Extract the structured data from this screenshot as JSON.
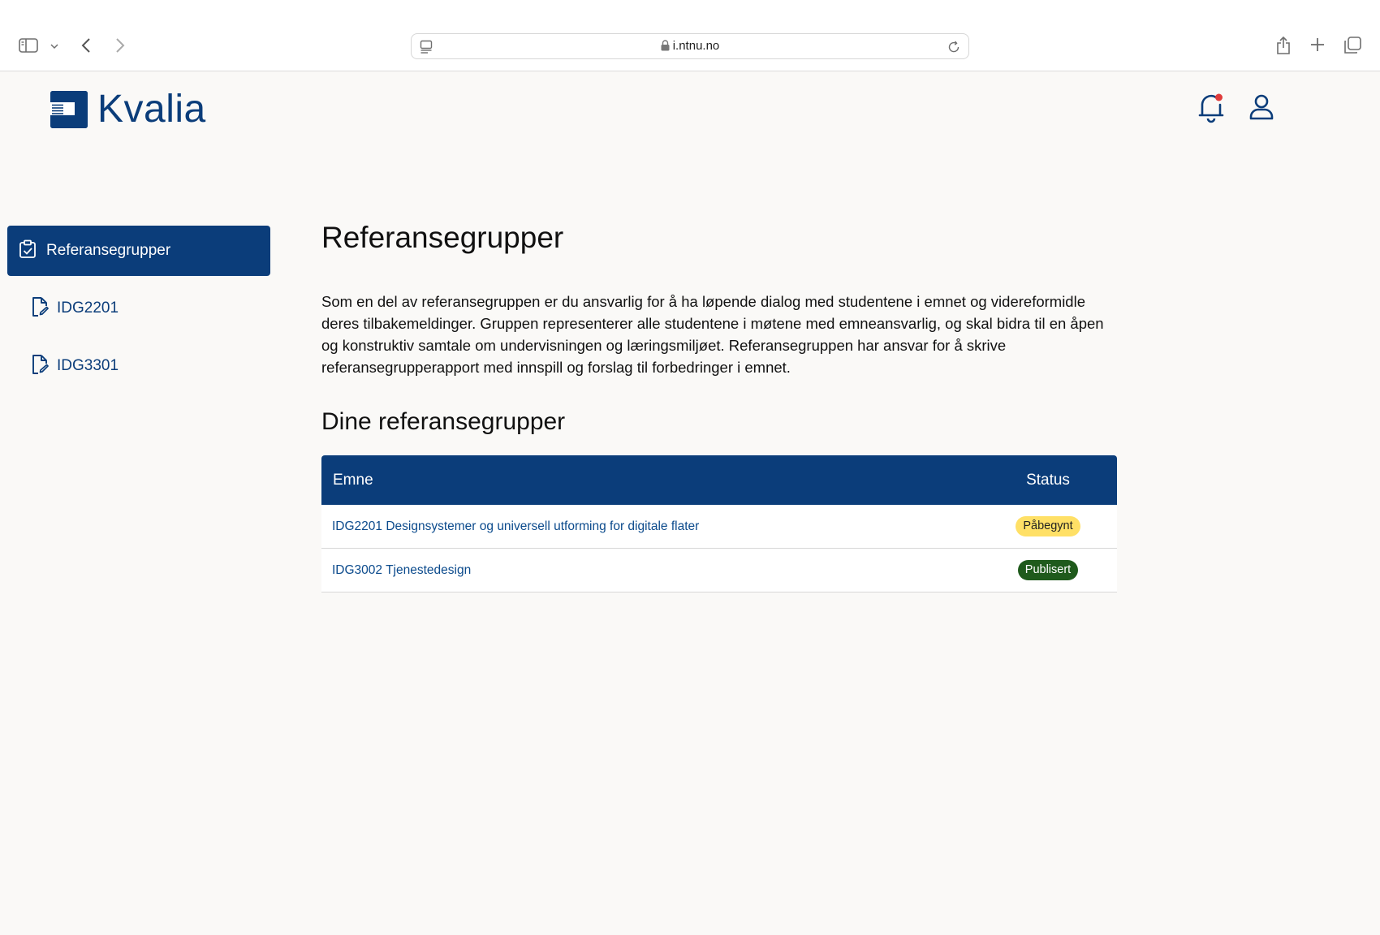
{
  "browser": {
    "url": "i.ntnu.no"
  },
  "header": {
    "logo_text": "Kvalia",
    "notification_color": "#e03c3c"
  },
  "sidebar": {
    "items": [
      {
        "label": "Referansegrupper",
        "icon": "clipboard-check-icon",
        "active": true
      },
      {
        "label": "IDG2201",
        "icon": "document-edit-icon",
        "active": false
      },
      {
        "label": "IDG3301",
        "icon": "document-edit-icon",
        "active": false
      }
    ]
  },
  "main": {
    "title": "Referansegrupper",
    "intro": "Som en del av referansegruppen er du ansvarlig for å ha løpende dialog med studentene i emnet og videreformidle deres tilbakemeldinger. Gruppen representerer alle studentene i møtene med emneansvarlig, og skal bidra til en åpen og konstruktiv samtale om undervisningen og læringsmiljøet. Referansegruppen har ansvar for å skrive referansegrupperapport med innspill og forslag til forbedringer i emnet.",
    "subtitle": "Dine referansegrupper",
    "table": {
      "headers": {
        "emne": "Emne",
        "status": "Status"
      },
      "rows": [
        {
          "emne": "IDG2201 Designsystemer og universell utforming for digitale flater",
          "status": "Påbegynt",
          "status_color": "#ffe066"
        },
        {
          "emne": "IDG3002 Tjenestedesign",
          "status": "Publisert",
          "status_color": "#1f5a1c"
        }
      ]
    }
  },
  "colors": {
    "brand": "#0b3d7a",
    "background": "#faf9f7"
  }
}
